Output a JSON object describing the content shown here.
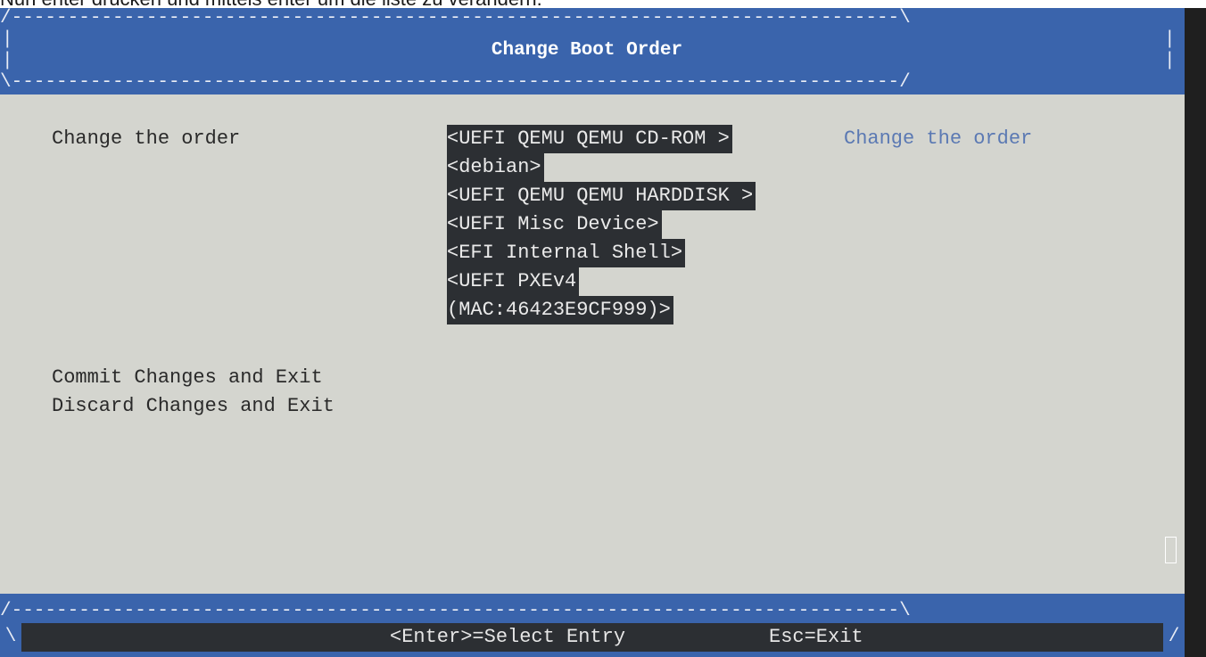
{
  "caption": "Nun enter drücken und mittels enter um die liste zu verändern.",
  "header": {
    "title": "Change Boot Order",
    "top_line": "/-------------------------------------------------------------------------------\\",
    "bottom_line": "\\-------------------------------------------------------------------------------/",
    "side_char": "|"
  },
  "main": {
    "change_order_label": "Change the order",
    "boot_entries": [
      "<UEFI QEMU QEMU CD-ROM >",
      "<debian>",
      "<UEFI QEMU QEMU HARDDISK >",
      "<UEFI Misc Device>",
      "<EFI Internal Shell>",
      "<UEFI PXEv4",
      "(MAC:46423E9CF999)>"
    ],
    "help_text": "Change the order",
    "commit_label": "Commit Changes and Exit",
    "discard_label": "Discard Changes and Exit"
  },
  "footer": {
    "top_line": "/-------------------------------------------------------------------------------\\",
    "left_char": "\\",
    "right_char": "/",
    "enter_hint": "<Enter>=Select Entry",
    "esc_hint": "Esc=Exit"
  },
  "colors": {
    "background": "#d4d5cf",
    "frame_blue": "#3a64ac",
    "highlight": "#2c2f33",
    "help_text": "#5b79b3"
  }
}
